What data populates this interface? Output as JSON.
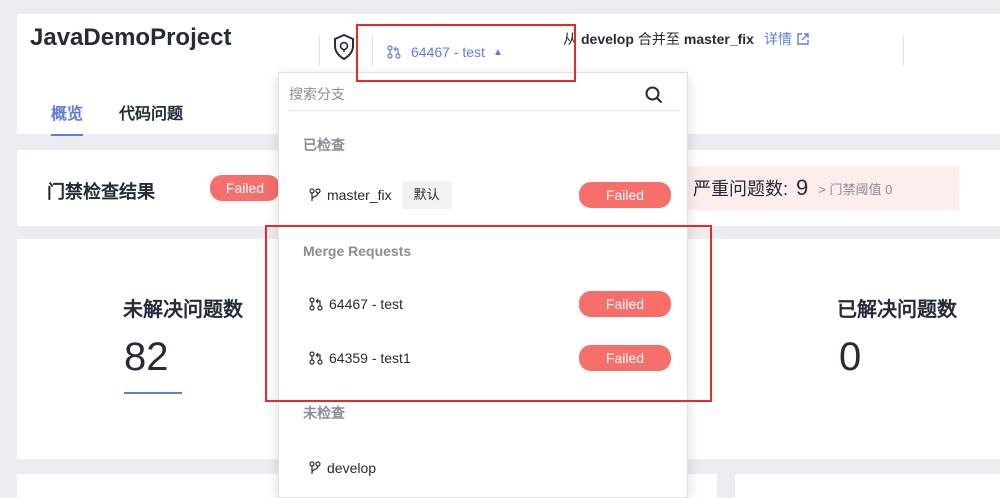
{
  "header": {
    "project_name": "JavaDemoProject",
    "selected_branch": "64467 - test",
    "merge": {
      "from_word": "从",
      "source": "develop",
      "to_word": "合并至",
      "target": "master_fix",
      "details_link": "详情"
    }
  },
  "tabs": [
    {
      "label": "概览",
      "active": true
    },
    {
      "label": "代码问题",
      "active": false
    }
  ],
  "gate": {
    "title": "门禁检查结果",
    "status": "Failed",
    "severe_label": "严重问题数:",
    "severe_count": "9",
    "threshold": "> 门禁阈值 0"
  },
  "stats": {
    "unresolved_label": "未解决问题数",
    "unresolved_value": "82",
    "resolved_label": "已解决问题数",
    "resolved_value": "0"
  },
  "dropdown": {
    "search_placeholder": "搜索分支",
    "groups": [
      {
        "title": "已检查",
        "items": [
          {
            "name": "master_fix",
            "tag": "默认",
            "status": "Failed",
            "icon": "branch-icon"
          }
        ]
      },
      {
        "title": "Merge Requests",
        "items": [
          {
            "name": "64467 - test",
            "status": "Failed",
            "icon": "merge-request-icon"
          },
          {
            "name": "64359 - test1",
            "status": "Failed",
            "icon": "merge-request-icon"
          }
        ]
      },
      {
        "title": "未检查",
        "items": [
          {
            "name": "develop",
            "icon": "branch-icon"
          }
        ]
      }
    ]
  },
  "colors": {
    "accent": "#5e7ce0",
    "failed": "#f66f6a",
    "highlight": "#e8292a"
  }
}
